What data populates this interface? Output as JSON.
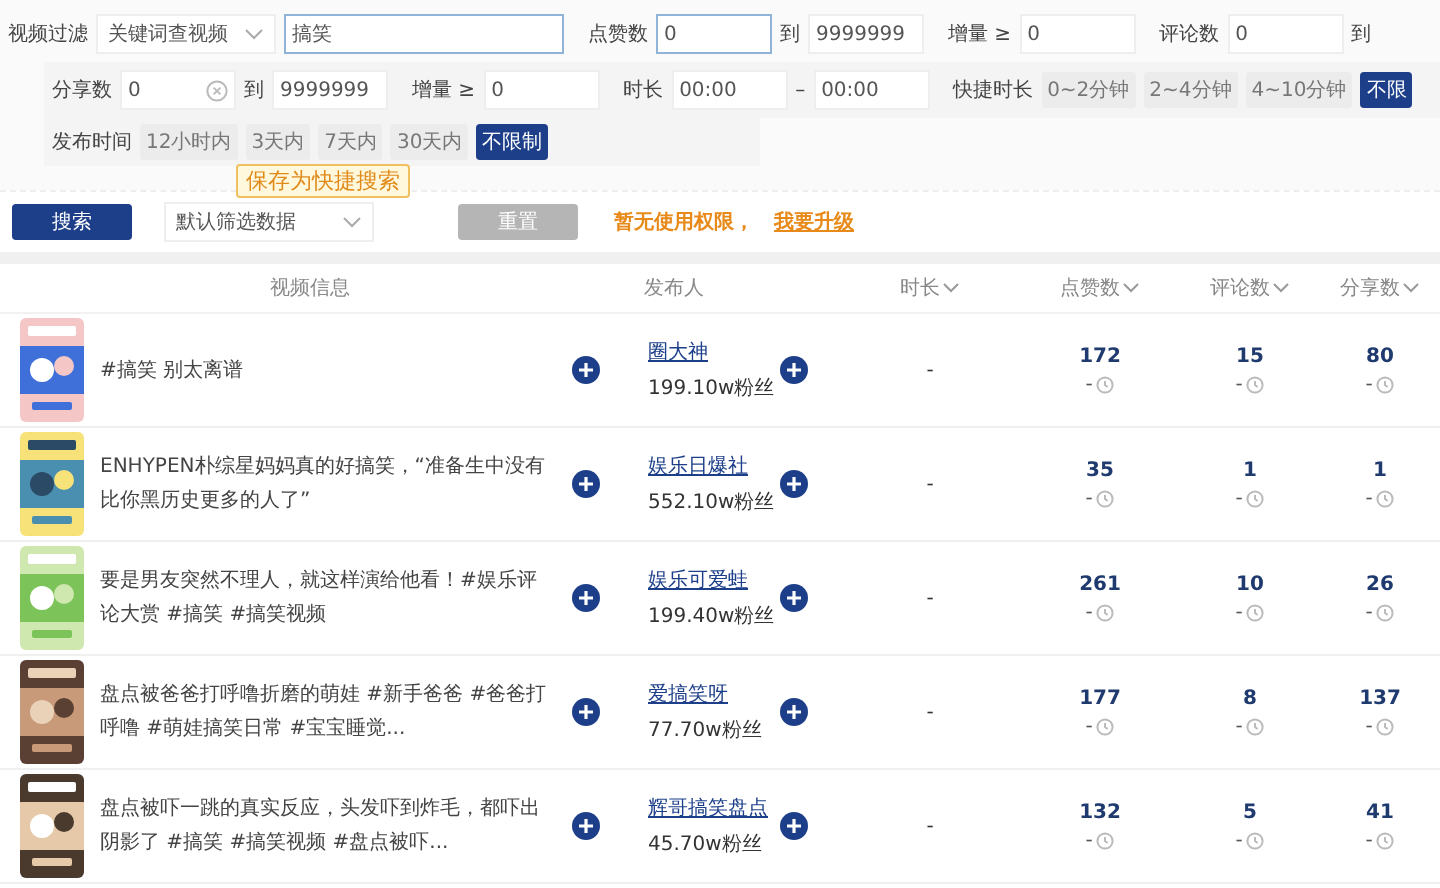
{
  "filter_rows": [
    {
      "groups": [
        [
          {
            "kind": "label",
            "text": "视频过滤"
          },
          {
            "kind": "select",
            "value": "关键词查视频"
          },
          {
            "kind": "keyword",
            "value": "搞笑",
            "focused": true
          }
        ],
        [
          {
            "kind": "label",
            "text": "点赞数"
          },
          {
            "kind": "input",
            "value": "0",
            "focused": true
          },
          {
            "kind": "label",
            "text": "到"
          },
          {
            "kind": "input",
            "value": "9999999",
            "focused": false
          }
        ],
        [
          {
            "kind": "label",
            "text": "增量 ≥"
          },
          {
            "kind": "input",
            "value": "0",
            "focused": false
          }
        ],
        [
          {
            "kind": "label",
            "text": "评论数"
          },
          {
            "kind": "input",
            "value": "0",
            "focused": false
          },
          {
            "kind": "label",
            "text": "到"
          }
        ]
      ]
    },
    {
      "groups": [
        [
          {
            "kind": "label",
            "text": "分享数"
          },
          {
            "kind": "input",
            "value": "0",
            "focused": false,
            "clearable": true
          },
          {
            "kind": "label",
            "text": "到"
          },
          {
            "kind": "input",
            "value": "9999999",
            "focused": false
          }
        ],
        [
          {
            "kind": "label",
            "text": "增量 ≥"
          },
          {
            "kind": "input",
            "value": "0",
            "focused": false
          }
        ],
        [
          {
            "kind": "label",
            "text": "时长"
          },
          {
            "kind": "input",
            "value": "00:00",
            "focused": false
          },
          {
            "kind": "label",
            "text": "–"
          },
          {
            "kind": "input",
            "value": "00:00",
            "focused": false
          }
        ],
        [
          {
            "kind": "label",
            "text": "快捷时长"
          },
          {
            "kind": "chip",
            "text": "0~2分钟",
            "selected": false
          },
          {
            "kind": "chip",
            "text": "2~4分钟",
            "selected": false
          },
          {
            "kind": "chip",
            "text": "4~10分钟",
            "selected": false
          },
          {
            "kind": "chip",
            "text": "不限",
            "selected": true
          }
        ]
      ]
    },
    {
      "groups": [
        [
          {
            "kind": "label",
            "text": "发布时间"
          },
          {
            "kind": "chip",
            "text": "12小时内",
            "selected": false
          },
          {
            "kind": "chip",
            "text": "3天内",
            "selected": false
          },
          {
            "kind": "chip",
            "text": "7天内",
            "selected": false
          },
          {
            "kind": "chip",
            "text": "30天内",
            "selected": false
          },
          {
            "kind": "chip",
            "text": "不限制",
            "selected": true
          }
        ]
      ],
      "tooltip": "保存为快捷搜索"
    }
  ],
  "actions": {
    "search_button": "搜索",
    "preset": "默认筛选数据",
    "reset_button": {
      "label": "重置",
      "disabled": true
    },
    "notice": "暂无使用权限，",
    "upgrade_link": "我要升级"
  },
  "table": {
    "columns": [
      {
        "label": "视频信息",
        "sortable": false
      },
      {
        "label": "发布人",
        "sortable": false
      },
      {
        "label": "时长",
        "sortable": true
      },
      {
        "label": "点赞数",
        "sortable": true
      },
      {
        "label": "评论数",
        "sortable": true
      },
      {
        "label": "分享数",
        "sortable": true
      }
    ],
    "rows": [
      {
        "title": "#搞笑 别太离谱",
        "author": "圈大神",
        "fans": "199.10w粉丝",
        "duration": "-",
        "likes": "172",
        "likes_delta": "-",
        "comments": "15",
        "comments_delta": "-",
        "shares": "80",
        "shares_delta": "-"
      },
      {
        "title": "ENHYPEN朴综星妈妈真的好搞笑，“准备生中没有比你黑历史更多的人了”",
        "author": "娱乐日爆社",
        "fans": "552.10w粉丝",
        "duration": "-",
        "likes": "35",
        "likes_delta": "-",
        "comments": "1",
        "comments_delta": "-",
        "shares": "1",
        "shares_delta": "-"
      },
      {
        "title": "要是男友突然不理人，就这样演给他看！#娱乐评论大赏 #搞笑 #搞笑视频",
        "author": "娱乐可爱蛙",
        "fans": "199.40w粉丝",
        "duration": "-",
        "likes": "261",
        "likes_delta": "-",
        "comments": "10",
        "comments_delta": "-",
        "shares": "26",
        "shares_delta": "-"
      },
      {
        "title": "盘点被爸爸打呼噜折磨的萌娃 #新手爸爸 #爸爸打呼噜 #萌娃搞笑日常 #宝宝睡觉...",
        "author": "爱搞笑呀",
        "fans": "77.70w粉丝",
        "duration": "-",
        "likes": "177",
        "likes_delta": "-",
        "comments": "8",
        "comments_delta": "-",
        "shares": "137",
        "shares_delta": "-"
      },
      {
        "title": "盘点被吓一跳的真实反应，头发吓到炸毛，都吓出阴影了 #搞笑 #搞笑视频 #盘点被吓...",
        "author": "辉哥搞笑盘点",
        "fans": "45.70w粉丝",
        "duration": "-",
        "likes": "132",
        "likes_delta": "-",
        "comments": "5",
        "comments_delta": "-",
        "shares": "41",
        "shares_delta": "-"
      }
    ]
  }
}
